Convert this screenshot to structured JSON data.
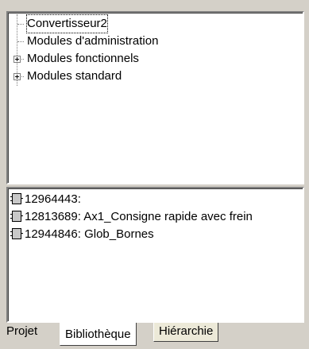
{
  "tree": {
    "items": [
      {
        "label": "Convertisseur2",
        "expandable": false,
        "selected": true
      },
      {
        "label": "Modules d'administration",
        "expandable": false,
        "selected": false
      },
      {
        "label": "Modules fonctionnels",
        "expandable": true,
        "selected": false
      },
      {
        "label": "Modules standard",
        "expandable": true,
        "selected": false
      }
    ]
  },
  "modules": {
    "items": [
      {
        "label": "12964443:"
      },
      {
        "label": "12813689: Ax1_Consigne rapide avec frein"
      },
      {
        "label": "12944846: Glob_Bornes"
      }
    ]
  },
  "tabs": [
    {
      "label": "Projet",
      "active": false
    },
    {
      "label": "Bibliothèque",
      "active": true
    },
    {
      "label": "Hiérarchie",
      "active": false
    }
  ]
}
